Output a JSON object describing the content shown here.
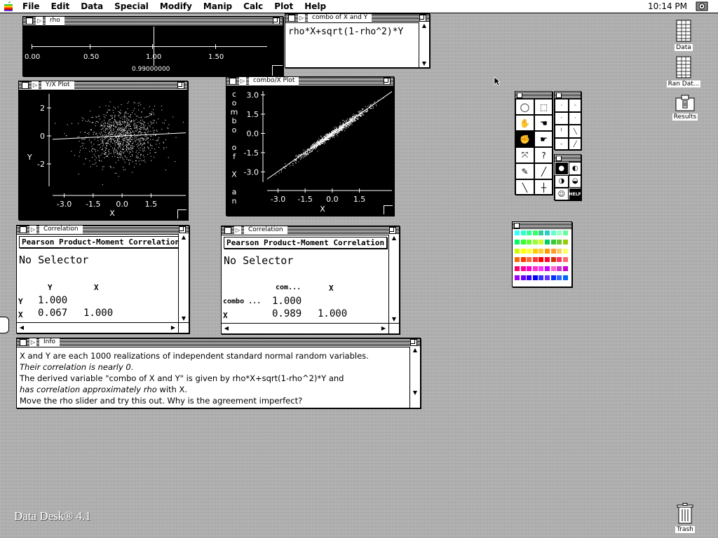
{
  "menubar": {
    "items": [
      "File",
      "Edit",
      "Data",
      "Special",
      "Modify",
      "Manip",
      "Calc",
      "Plot",
      "Help"
    ],
    "clock": "10:14 PM"
  },
  "rho_window": {
    "title": "rho",
    "ticks": [
      "0.00",
      "0.50",
      "1.00",
      "1.50"
    ],
    "value": "0.99000000",
    "slider_fraction": 0.55
  },
  "formula_window": {
    "title": "combo of X and Y",
    "formula": "rho*X+sqrt(1-rho^2)*Y"
  },
  "yx_plot": {
    "title": "Y/X Plot",
    "ylabel": "Y",
    "xlabel": "X"
  },
  "combo_plot": {
    "title": "combo/X Plot",
    "ylabel_letters": [
      "c",
      "o",
      "m",
      "b",
      "o",
      " ",
      "o",
      "f",
      " ",
      "X",
      " ",
      "a",
      "n"
    ],
    "xlabel": "X"
  },
  "corr1": {
    "title": "Correlation",
    "heading": "Pearson Product-Moment Correlation",
    "selector": "No Selector",
    "cols": [
      "Y",
      "X"
    ],
    "rows": [
      {
        "label": "Y",
        "values": [
          "1.000",
          ""
        ]
      },
      {
        "label": "X",
        "values": [
          "0.067",
          "1.000"
        ]
      }
    ]
  },
  "corr2": {
    "title": "Correlation",
    "heading": "Pearson Product-Moment Correlation",
    "selector": "No Selector",
    "cols": [
      "com...",
      "X"
    ],
    "rows": [
      {
        "label": "combo ...",
        "values": [
          "1.000",
          ""
        ]
      },
      {
        "label": "X",
        "values": [
          "0.989",
          "1.000"
        ]
      }
    ]
  },
  "info": {
    "title": "Info",
    "lines": [
      "X and Y are each 1000 realizations of independent standard normal random variables.",
      "Their correlation is nearly 0.",
      "The derived variable \"combo of X and Y\" is given by rho*X+sqrt(1-rho^2)*Y and",
      "has correlation approximately rho",
      " with X.",
      "Move the rho slider and try this out. Why is the agreement imperfect?"
    ]
  },
  "desktop": {
    "icons": [
      "Data",
      "Ran Dat...",
      "Results",
      "Trash"
    ],
    "watermark": "Data Desk® 4.1"
  },
  "chart_data": [
    {
      "type": "scatter",
      "title": "Y/X Plot",
      "xlabel": "X",
      "ylabel": "Y",
      "xticks": [
        "-3.0",
        "-1.5",
        "0.0",
        "1.5"
      ],
      "yticks": [
        "2",
        "0",
        "-2"
      ],
      "xlim": [
        -3.6,
        3.3
      ],
      "ylim": [
        -3.6,
        3.0
      ],
      "n_points": 1000,
      "correlation": 0.067,
      "colors": {
        "background": "#000000",
        "points": "#ffffff"
      }
    },
    {
      "type": "scatter",
      "title": "combo/X Plot",
      "xlabel": "X",
      "ylabel": "combo of X and Y",
      "xticks": [
        "-3.0",
        "-1.5",
        "0.0",
        "1.5"
      ],
      "yticks": [
        "3.0",
        "1.5",
        "0.0",
        "-1.5",
        "-3.0"
      ],
      "xlim": [
        -3.6,
        3.3
      ],
      "ylim": [
        -3.8,
        3.3
      ],
      "n_points": 1000,
      "correlation": 0.989,
      "colors": {
        "background": "#000000",
        "points": "#ffffff"
      }
    }
  ],
  "palette": {
    "tools": [
      "lasso",
      "marquee",
      "hand",
      "grab-hand",
      "select-hand",
      "point-hand",
      "expand",
      "help",
      "paint-brush",
      "pencil",
      "line",
      "crosshair"
    ],
    "swatch_rows": [
      [
        "#33ffff",
        "#33ffcc",
        "#33ff99",
        "#33ff66",
        "#33cc99",
        "#33cccc",
        "#66ffcc",
        "#99ffcc",
        "#66ff99"
      ],
      [
        "#00ff66",
        "#33ff33",
        "#66ff33",
        "#99ff33",
        "#ccff33",
        "#00cc66",
        "#33cc33",
        "#66cc33",
        "#99cc00"
      ],
      [
        "#ccff00",
        "#ffff00",
        "#ffff33",
        "#ffcc00",
        "#ffcc33",
        "#ff9900",
        "#ff9933",
        "#ffcc66",
        "#ffff66"
      ],
      [
        "#ff6600",
        "#ff3300",
        "#ff6633",
        "#ff3333",
        "#ff0000",
        "#ff0033",
        "#cc3300",
        "#ff3366",
        "#ff6666"
      ],
      [
        "#ff0066",
        "#ff0099",
        "#ff00cc",
        "#ff33cc",
        "#ff33ff",
        "#cc00ff",
        "#ff66cc",
        "#cc33cc",
        "#cc00cc"
      ],
      [
        "#9900ff",
        "#6600ff",
        "#3300ff",
        "#0000ff",
        "#3333ff",
        "#6633ff",
        "#0033ff",
        "#3366ff",
        "#0066ff"
      ]
    ]
  }
}
